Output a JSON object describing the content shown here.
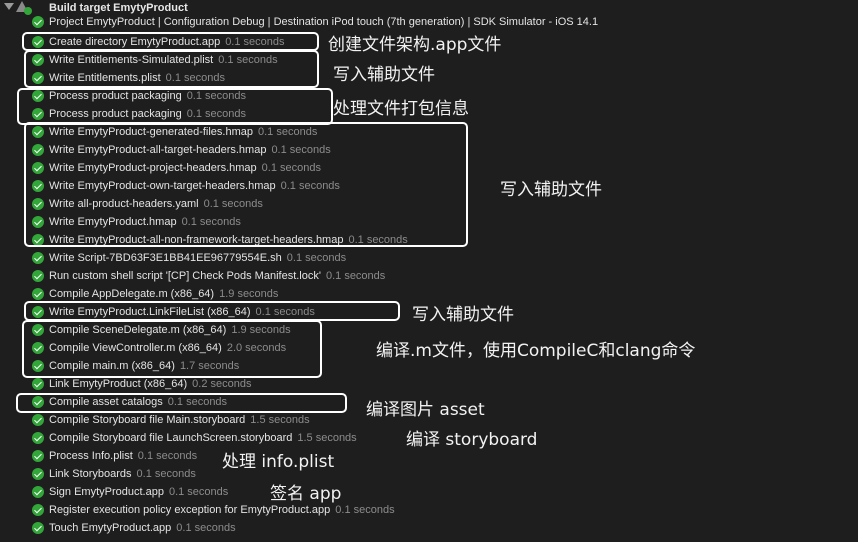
{
  "header": {
    "title": "Build target EmytyProduct"
  },
  "steps": [
    {
      "text": "Project EmytyProduct | Configuration Debug | Destination iPod touch (7th generation) | SDK Simulator - iOS 14.1",
      "duration": ""
    },
    {
      "text": "Create directory EmytyProduct.app",
      "duration": "0.1 seconds"
    },
    {
      "text": "Write Entitlements-Simulated.plist",
      "duration": "0.1 seconds"
    },
    {
      "text": "Write Entitlements.plist",
      "duration": "0.1 seconds"
    },
    {
      "text": "Process product packaging",
      "duration": "0.1 seconds"
    },
    {
      "text": "Process product packaging",
      "duration": "0.1 seconds"
    },
    {
      "text": "Write EmytyProduct-generated-files.hmap",
      "duration": "0.1 seconds"
    },
    {
      "text": "Write EmytyProduct-all-target-headers.hmap",
      "duration": "0.1 seconds"
    },
    {
      "text": "Write EmytyProduct-project-headers.hmap",
      "duration": "0.1 seconds"
    },
    {
      "text": "Write EmytyProduct-own-target-headers.hmap",
      "duration": "0.1 seconds"
    },
    {
      "text": "Write all-product-headers.yaml",
      "duration": "0.1 seconds"
    },
    {
      "text": "Write EmytyProduct.hmap",
      "duration": "0.1 seconds"
    },
    {
      "text": "Write EmytyProduct-all-non-framework-target-headers.hmap",
      "duration": "0.1 seconds"
    },
    {
      "text": "Write Script-7BD63F3E1BB41EE96779554E.sh",
      "duration": "0.1 seconds"
    },
    {
      "text": "Run custom shell script '[CP] Check Pods Manifest.lock'",
      "duration": "0.1 seconds"
    },
    {
      "text": "Compile AppDelegate.m (x86_64)",
      "duration": "1.9 seconds"
    },
    {
      "text": "Write EmytyProduct.LinkFileList (x86_64)",
      "duration": "0.1 seconds"
    },
    {
      "text": "Compile SceneDelegate.m (x86_64)",
      "duration": "1.9 seconds"
    },
    {
      "text": "Compile ViewController.m (x86_64)",
      "duration": "2.0 seconds"
    },
    {
      "text": "Compile main.m (x86_64)",
      "duration": "1.7 seconds"
    },
    {
      "text": "Link EmytyProduct (x86_64)",
      "duration": "0.2 seconds"
    },
    {
      "text": "Compile asset catalogs",
      "duration": "0.1 seconds"
    },
    {
      "text": "Compile Storyboard file Main.storyboard",
      "duration": "1.5 seconds"
    },
    {
      "text": "Compile Storyboard file LaunchScreen.storyboard",
      "duration": "1.5 seconds"
    },
    {
      "text": "Process Info.plist",
      "duration": "0.1 seconds"
    },
    {
      "text": "Link Storyboards",
      "duration": "0.1 seconds"
    },
    {
      "text": "Sign EmytyProduct.app",
      "duration": "0.1 seconds"
    },
    {
      "text": "Register execution policy exception for EmytyProduct.app",
      "duration": "0.1 seconds"
    },
    {
      "text": "Touch EmytyProduct.app",
      "duration": "0.1 seconds"
    }
  ],
  "annotations": [
    "创建文件架构.app文件",
    "写入辅助文件",
    "处理文件打包信息",
    "写入辅助文件",
    "写入辅助文件",
    "编译.m文件，使用CompileC和clang命令",
    "编译图片 asset",
    "编译 storyboard",
    "处理 info.plist",
    "签名 app"
  ],
  "colors": {
    "background": "#1e1e1e",
    "success": "#33a63a",
    "step_text": "#e4e4e4",
    "duration_text": "#8c8c8c",
    "annotation": "#ffffff"
  }
}
